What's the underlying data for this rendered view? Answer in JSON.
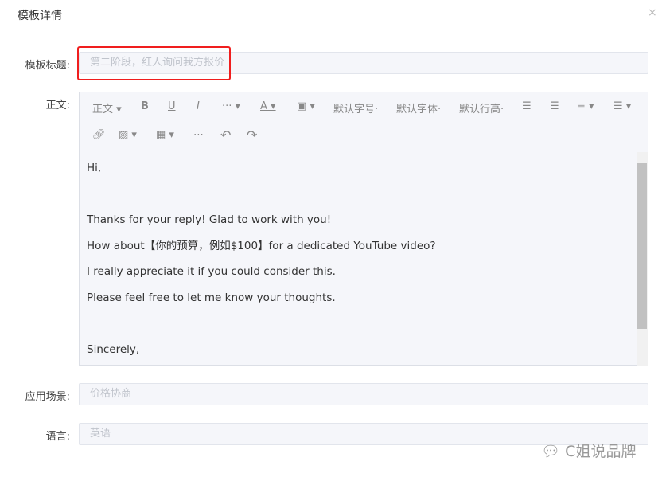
{
  "dialog": {
    "title": "模板详情",
    "close": "×"
  },
  "fields": {
    "title_label": "模板标题:",
    "title_placeholder": "第二阶段，红人询问我方报价",
    "body_label": "正文:",
    "scene_label": "应用场景:",
    "scene_placeholder": "价格协商",
    "lang_label": "语言:",
    "lang_placeholder": "英语"
  },
  "toolbar": {
    "paragraph": "正文",
    "font_size": "默认字号",
    "font_family": "默认字体",
    "line_height": "默认行高"
  },
  "body_lines": [
    "Hi,",
    "",
    "Thanks for your reply! Glad to work with you!",
    "How about【你的预算，例如$100】for a dedicated YouTube video?",
    "I really appreciate it if you could consider this.",
    "Please feel free to let me know your thoughts.",
    "",
    "Sincerely,"
  ],
  "watermark": "C姐说品牌",
  "colors": {
    "highlight": "#f01e1e",
    "input_bg": "#f5f6fa"
  }
}
